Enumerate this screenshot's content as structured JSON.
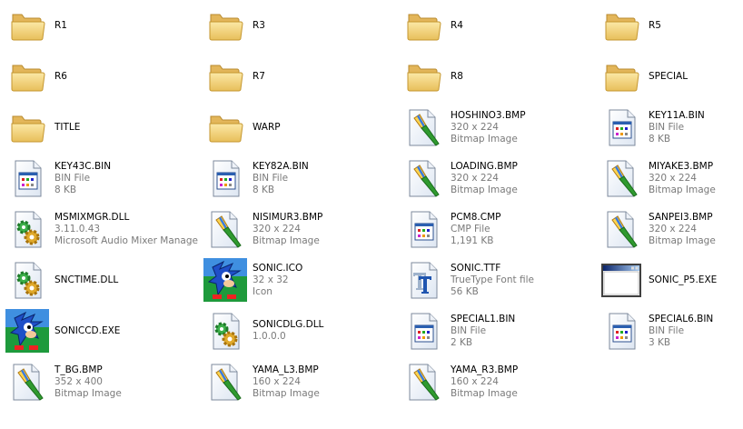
{
  "window": {
    "view": "Tiles"
  },
  "items": [
    {
      "name": "R1",
      "type": "folder"
    },
    {
      "name": "R3",
      "type": "folder"
    },
    {
      "name": "R4",
      "type": "folder"
    },
    {
      "name": "R5",
      "type": "folder"
    },
    {
      "name": "R6",
      "type": "folder"
    },
    {
      "name": "R7",
      "type": "folder"
    },
    {
      "name": "R8",
      "type": "folder"
    },
    {
      "name": "SPECIAL",
      "type": "folder"
    },
    {
      "name": "TITLE",
      "type": "folder"
    },
    {
      "name": "WARP",
      "type": "folder"
    },
    {
      "name": "HOSHINO3.BMP",
      "type": "bitmap",
      "line2": "320 x 224",
      "line3": "Bitmap Image"
    },
    {
      "name": "KEY11A.BIN",
      "type": "bin",
      "line2": "BIN File",
      "line3": "8 KB"
    },
    {
      "name": "KEY43C.BIN",
      "type": "bin",
      "line2": "BIN File",
      "line3": "8 KB"
    },
    {
      "name": "KEY82A.BIN",
      "type": "bin",
      "line2": "BIN File",
      "line3": "8 KB"
    },
    {
      "name": "LOADING.BMP",
      "type": "bitmap",
      "line2": "320 x 224",
      "line3": "Bitmap Image"
    },
    {
      "name": "MIYAKE3.BMP",
      "type": "bitmap",
      "line2": "320 x 224",
      "line3": "Bitmap Image"
    },
    {
      "name": "MSMIXMGR.DLL",
      "type": "dll",
      "line2": "3.11.0.43",
      "line3": "Microsoft Audio Mixer Manager"
    },
    {
      "name": "NISIMUR3.BMP",
      "type": "bitmap",
      "line2": "320 x 224",
      "line3": "Bitmap Image"
    },
    {
      "name": "PCM8.CMP",
      "type": "bin",
      "line2": "CMP File",
      "line3": "1,191 KB"
    },
    {
      "name": "SANPEI3.BMP",
      "type": "bitmap",
      "line2": "320 x 224",
      "line3": "Bitmap Image"
    },
    {
      "name": "SNCTIME.DLL",
      "type": "dll"
    },
    {
      "name": "SONIC.ICO",
      "type": "sonic",
      "line2": "32 x 32",
      "line3": "Icon"
    },
    {
      "name": "SONIC.TTF",
      "type": "font",
      "line2": "TrueType Font file",
      "line3": "56 KB"
    },
    {
      "name": "SONIC_P5.EXE",
      "type": "exe"
    },
    {
      "name": "SONICCD.EXE",
      "type": "sonic"
    },
    {
      "name": "SONICDLG.DLL",
      "type": "dll",
      "line2": "1.0.0.0"
    },
    {
      "name": "SPECIAL1.BIN",
      "type": "bin",
      "line2": "BIN File",
      "line3": "2 KB"
    },
    {
      "name": "SPECIAL6.BIN",
      "type": "bin",
      "line2": "BIN File",
      "line3": "3 KB"
    },
    {
      "name": "T_BG.BMP",
      "type": "bitmap",
      "line2": "352 x 400",
      "line3": "Bitmap Image"
    },
    {
      "name": "YAMA_L3.BMP",
      "type": "bitmap",
      "line2": "160 x 224",
      "line3": "Bitmap Image"
    },
    {
      "name": "YAMA_R3.BMP",
      "type": "bitmap",
      "line2": "160 x 224",
      "line3": "Bitmap Image"
    }
  ],
  "colors": {
    "folder": "#f2d27a",
    "folder_dark": "#d9a944",
    "secondary_text": "#7a7a7a",
    "brush": "#2f9a2f",
    "sonic_blue": "#1f5fd0"
  }
}
